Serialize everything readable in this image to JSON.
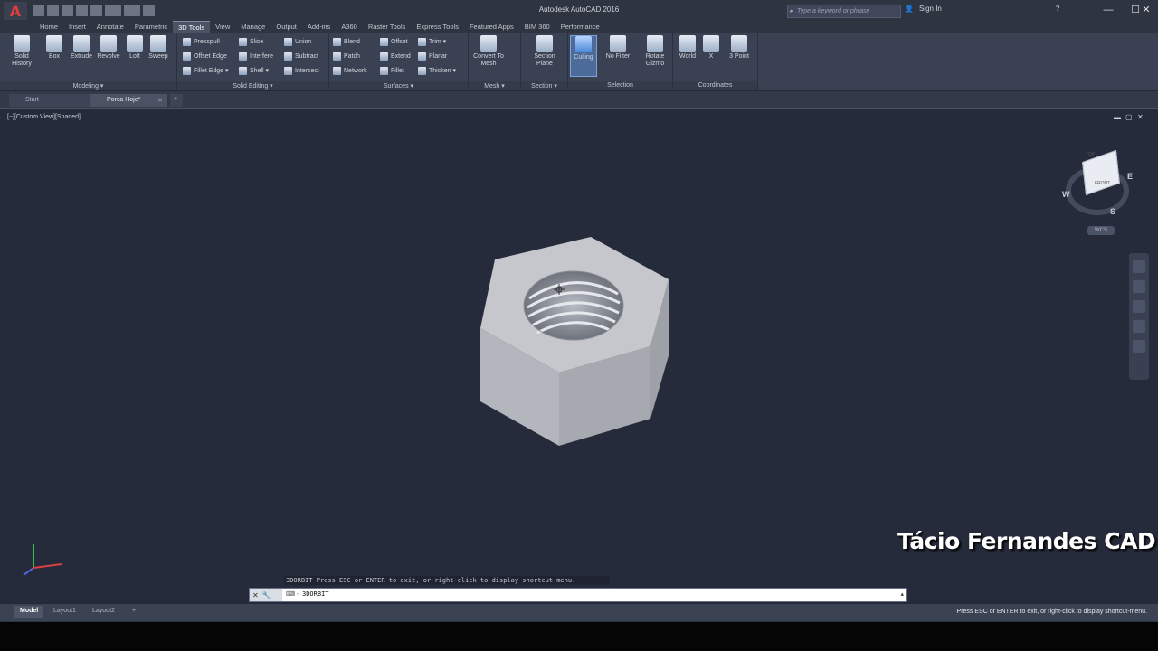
{
  "window": {
    "logo": "A",
    "title": "Autodesk AutoCAD 2016",
    "search_placeholder": "Type a keyword or phrase",
    "signin": "Sign In",
    "help": "?",
    "minimize": "—",
    "maximize": "☐",
    "close": "✕"
  },
  "tabs": [
    "Home",
    "Insert",
    "Annotate",
    "Parametric",
    "3D Tools",
    "View",
    "Manage",
    "Output",
    "Add-ins",
    "A360",
    "Raster Tools",
    "Express Tools",
    "Featured Apps",
    "BIM 360",
    "Performance"
  ],
  "active_tab_index": 4,
  "ribbon": {
    "modeling": {
      "title": "Modeling ▾",
      "buttons": [
        "Solid History",
        "Box",
        "Extrude",
        "Revolve",
        "Loft",
        "Sweep"
      ]
    },
    "solid_editing": {
      "title": "Solid Editing ▾",
      "buttons": [
        "Presspull",
        "Offset Edge",
        "Fillet Edge ▾",
        "Slice",
        "Interfere",
        "Shell ▾",
        "Union",
        "Subtract",
        "Intersect"
      ]
    },
    "surfaces": {
      "title": "Surfaces ▾",
      "buttons": [
        "Blend",
        "Patch",
        "Network",
        "Offset",
        "Extend",
        "Fillet",
        "Trim ▾",
        "Planar",
        "Thicken ▾"
      ]
    },
    "mesh": {
      "title": "Mesh ▾",
      "buttons": [
        "Convert To Mesh"
      ]
    },
    "section": {
      "title": "Section ▾",
      "buttons": [
        "Section Plane"
      ]
    },
    "selection": {
      "title": "Selection",
      "buttons": [
        "Culling",
        "No Filter",
        "Rotate Gizmo"
      ]
    },
    "coordinates": {
      "title": "Coordinates",
      "buttons": [
        "World",
        "X",
        "3 Point"
      ]
    }
  },
  "doc_tabs": {
    "start": "Start",
    "file": "Porca Hoje*",
    "add": "+"
  },
  "viewport": {
    "label": "[−][Custom View][Shaded]",
    "controls": [
      "▬",
      "▢",
      "✕"
    ],
    "viewcube": {
      "top": "TOP",
      "front": "FRONT",
      "w": "W",
      "e": "E",
      "s": "S",
      "wcs": "WCS"
    }
  },
  "watermark": "Tácio Fernandes CAD",
  "command": {
    "history": "3DORBIT Press ESC or ENTER to exit, or right-click to display shortcut-menu.",
    "tools": "✕ 🔧",
    "prompt": "⌨ -",
    "input": "3DORBIT",
    "arrow": "▴"
  },
  "status": {
    "layouts": [
      "Model",
      "Layout1",
      "Layout2",
      "+"
    ],
    "message": "Press ESC or ENTER to exit, or right-click to display shortcut-menu."
  },
  "colors": {
    "viewport_bg": "#252b3a",
    "ribbon_bg": "#3a4152",
    "accent": "#4d6b99",
    "watermark": "#ffffff"
  }
}
